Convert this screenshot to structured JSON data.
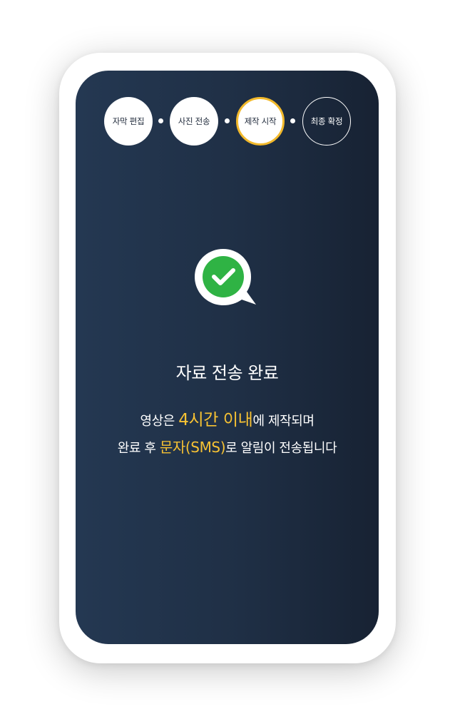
{
  "steps": [
    {
      "label": "자막 편집",
      "state": "done"
    },
    {
      "label": "사진 전송",
      "state": "done"
    },
    {
      "label": "제작 시작",
      "state": "current"
    },
    {
      "label": "최종 확정",
      "state": "pending"
    }
  ],
  "status_icon": "check-speech-bubble-icon",
  "title": "자료 전송 완료",
  "message": {
    "line1_a": "영상은 ",
    "line1_highlight": "4시간 이내",
    "line1_b": "에 제작되며",
    "line2_a": "완료 후 ",
    "line2_highlight": "문자(SMS)",
    "line2_b": "로 알림이 전송됩니다"
  },
  "colors": {
    "accent": "#f7c233",
    "check_green": "#2fb344",
    "screen_bg": "#1f2f45"
  }
}
